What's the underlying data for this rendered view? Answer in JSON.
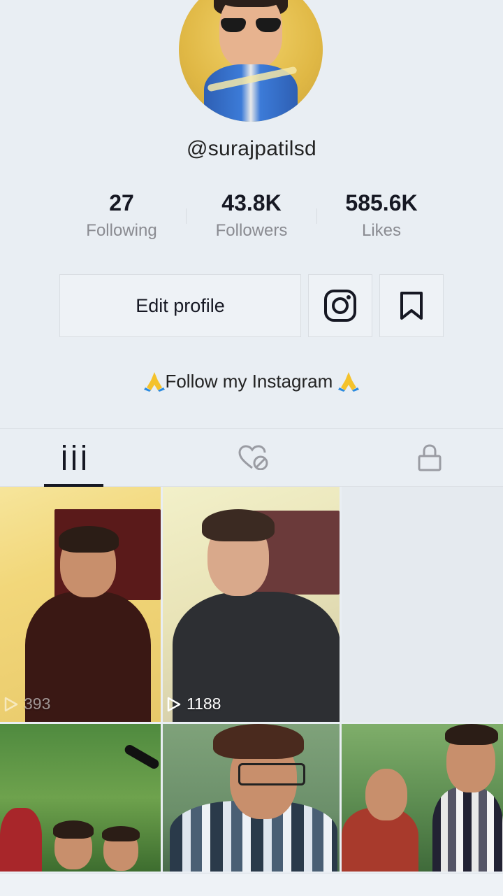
{
  "profile": {
    "username": "@surajpatilsd",
    "stats": [
      {
        "value": "27",
        "label": "Following"
      },
      {
        "value": "43.8K",
        "label": "Followers"
      },
      {
        "value": "585.6K",
        "label": "Likes"
      }
    ],
    "edit_profile_label": "Edit profile",
    "bio": "Follow my Instagram"
  },
  "tabs": [
    {
      "name": "videos",
      "icon": "grid-icon",
      "active": true
    },
    {
      "name": "liked",
      "icon": "liked-hidden-icon",
      "active": false
    },
    {
      "name": "private",
      "icon": "lock-icon",
      "active": false
    }
  ],
  "videos": [
    {
      "views": "393"
    },
    {
      "views": "1188"
    },
    {
      "views": ""
    },
    {
      "views": ""
    },
    {
      "views": ""
    },
    {
      "views": ""
    }
  ],
  "colors": {
    "background": "#e9eef3",
    "text_primary": "#161823",
    "text_secondary": "#8a8b91"
  }
}
